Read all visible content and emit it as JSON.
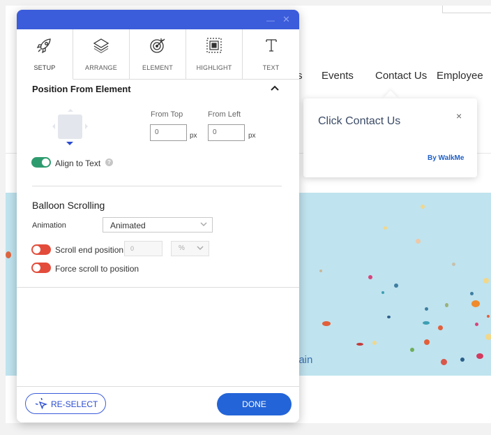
{
  "site": {
    "nav_fragment": "s",
    "nav_items": [
      {
        "label": "Events"
      },
      {
        "label": "Contact Us"
      },
      {
        "label": "Employee"
      }
    ],
    "hero_text": "hain"
  },
  "balloon": {
    "title": "Click Contact Us",
    "close": "×",
    "branding": "By WalkMe"
  },
  "panel": {
    "window_controls": {
      "minimize": "—",
      "close": "✕"
    },
    "tabs": [
      {
        "label": "SETUP",
        "icon": "rocket-icon",
        "active": true
      },
      {
        "label": "ARRANGE",
        "icon": "layers-icon",
        "active": false
      },
      {
        "label": "ELEMENT",
        "icon": "target-icon",
        "active": false
      },
      {
        "label": "HIGHLIGHT",
        "icon": "highlight-icon",
        "active": false
      },
      {
        "label": "TEXT",
        "icon": "text-icon",
        "active": false
      }
    ],
    "position": {
      "title": "Position From Element",
      "from_top_label": "From Top",
      "from_left_label": "From Left",
      "from_top_value": "0",
      "from_left_value": "0",
      "unit": "px",
      "align_to_text_label": "Align to Text",
      "align_to_text": true,
      "help": "?"
    },
    "scrolling": {
      "title": "Balloon Scrolling",
      "animation_label": "Animation",
      "animation_value": "Animated",
      "scroll_end_label": "Scroll end position",
      "scroll_end_enabled": false,
      "scroll_end_placeholder": "0",
      "scroll_unit": "%",
      "force_scroll_label": "Force scroll to position",
      "force_scroll_enabled": false
    },
    "footer": {
      "reselect_label": "RE-SELECT",
      "done_label": "DONE"
    }
  },
  "colors": {
    "header_blue": "#3b5cdb",
    "toggle_on": "#2e9b6e",
    "toggle_off": "#e34c3a",
    "done_blue": "#2364d8",
    "hero_bg": "#bfe3ef"
  }
}
